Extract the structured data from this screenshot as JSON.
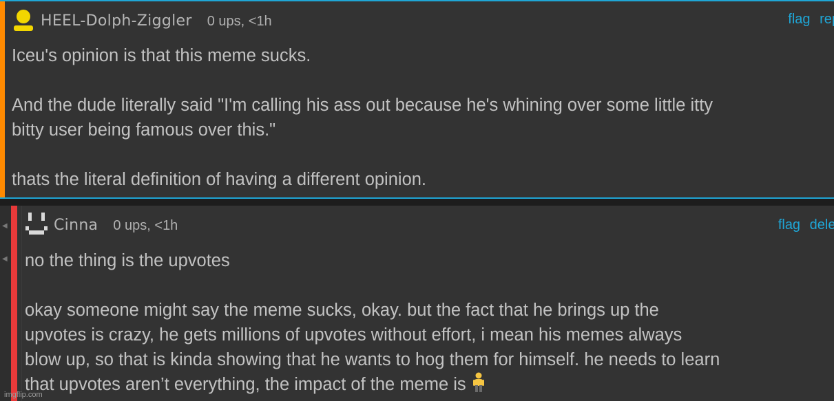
{
  "comments": [
    {
      "username": "HEEL-Dolph-Ziggler",
      "meta": "0 ups, <1h",
      "actions": [
        "flag",
        "rep"
      ],
      "lines": [
        "Iceu's opinion is that this meme sucks.",
        "",
        "And the dude literally said \"I'm calling his ass out because he's whining over some little itty",
        "bitty user being famous over this.\"",
        "",
        "thats the literal definition of having a different opinion."
      ],
      "colors": {
        "stripe": "#ff8a00",
        "avatar": "#f2d600"
      }
    },
    {
      "username": "Cinna",
      "meta": "0 ups, <1h",
      "actions": [
        "flag",
        "delet"
      ],
      "lines": [
        "no the thing is the upvotes",
        "",
        "okay someone might say the meme sucks, okay. but the fact that he brings up the",
        "upvotes is crazy, he gets millions of upvotes without effort, i mean his memes always",
        "blow up, so that is kinda showing that he wants to hog them for himself. he needs to learn",
        "that upvotes aren’t everything, the impact of the meme is"
      ],
      "emoji": "person-standing-emoji",
      "colors": {
        "stripe": "#e83a3a",
        "avatar": "#d9d9d9"
      }
    }
  ],
  "watermark": "imgflip.com",
  "accent": "#1fa6d6"
}
